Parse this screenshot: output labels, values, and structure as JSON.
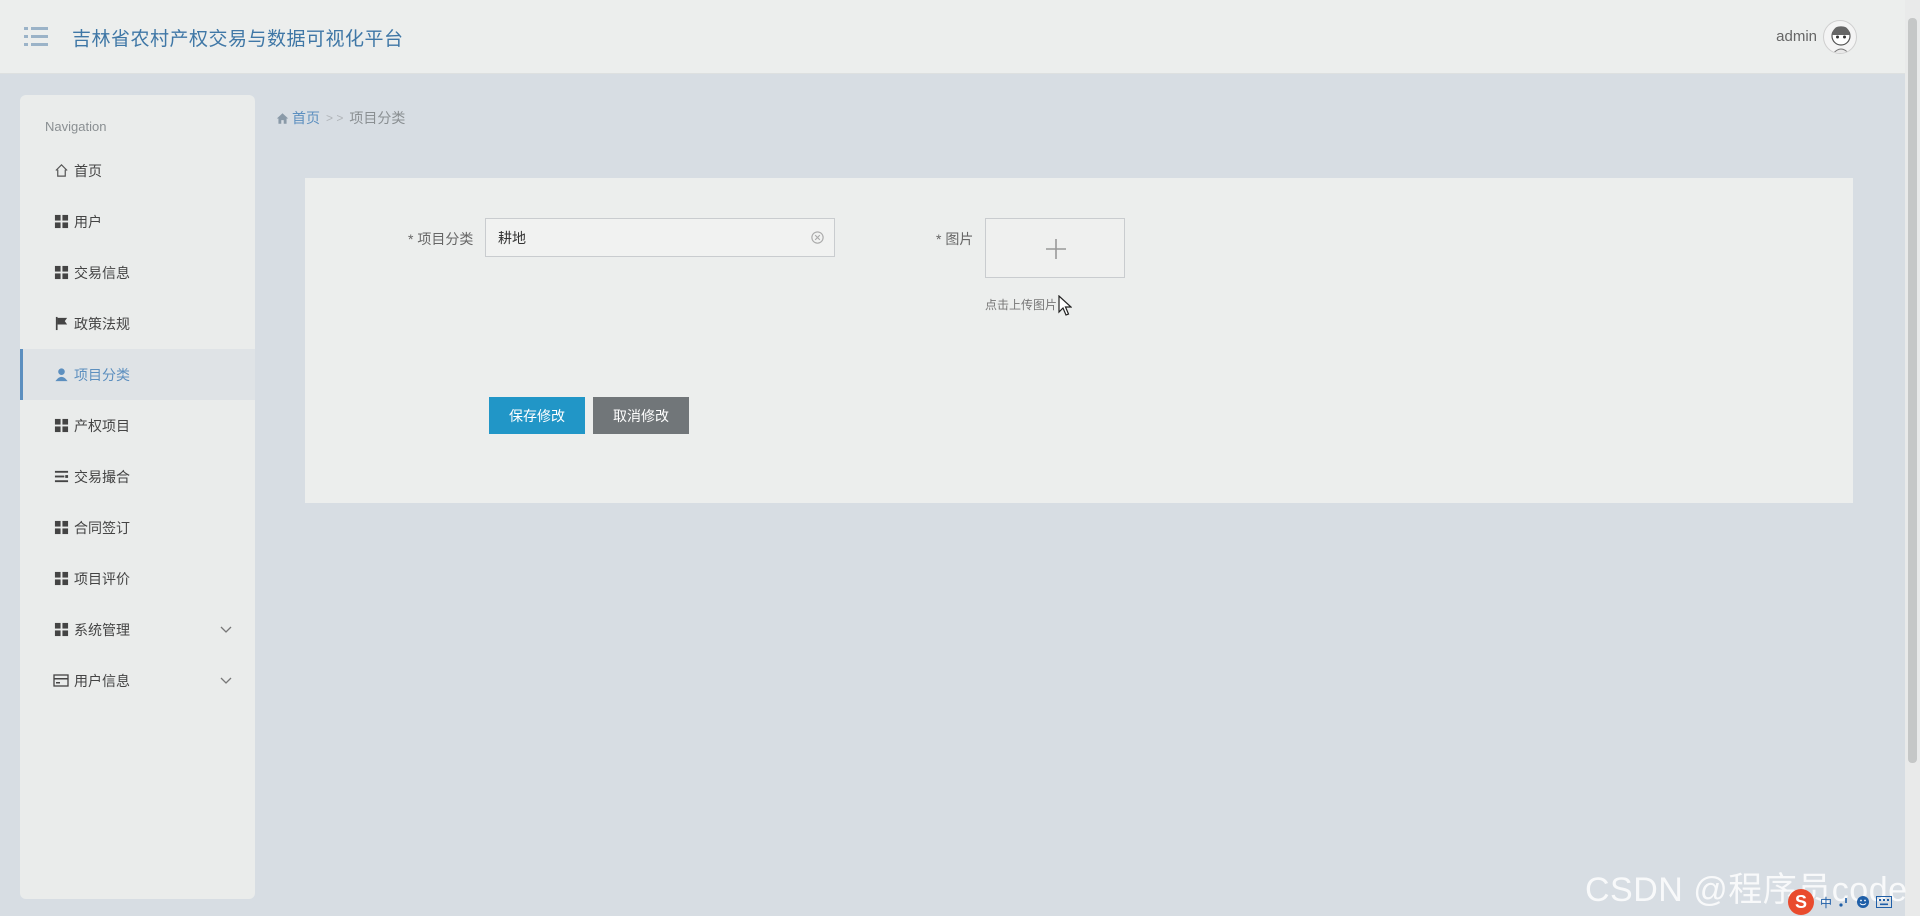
{
  "header": {
    "title": "吉林省农村产权交易与数据可视化平台",
    "user": "admin",
    "menu_icon": "menu-icon",
    "avatar_icon": "avatar"
  },
  "sidebar": {
    "heading": "Navigation",
    "items": [
      {
        "label": "首页",
        "icon": "home-icon"
      },
      {
        "label": "用户",
        "icon": "grid-icon"
      },
      {
        "label": "交易信息",
        "icon": "grid-icon"
      },
      {
        "label": "政策法规",
        "icon": "flag-icon"
      },
      {
        "label": "项目分类",
        "icon": "user-icon",
        "active": true
      },
      {
        "label": "产权项目",
        "icon": "grid-icon"
      },
      {
        "label": "交易撮合",
        "icon": "list-icon"
      },
      {
        "label": "合同签订",
        "icon": "grid-icon"
      },
      {
        "label": "项目评价",
        "icon": "grid-icon"
      },
      {
        "label": "系统管理",
        "icon": "grid-icon",
        "expandable": true
      },
      {
        "label": "用户信息",
        "icon": "card-icon",
        "expandable": true
      }
    ]
  },
  "breadcrumb": {
    "home": "首页",
    "separator": "> >",
    "current": "项目分类"
  },
  "form": {
    "category_label": "* 项目分类",
    "category_value": "耕地",
    "image_label": "* 图片",
    "upload_hint": "点击上传图片",
    "save_button": "保存修改",
    "cancel_button": "取消修改"
  },
  "watermark": "CSDN @程序员code",
  "tray": {
    "logo": "S",
    "ime": "中"
  },
  "colors": {
    "accent": "#5c8fbf",
    "title": "#3f77a6",
    "primary_button": "#2196c7",
    "secondary_button": "#717679",
    "background": "#d7dde3"
  }
}
